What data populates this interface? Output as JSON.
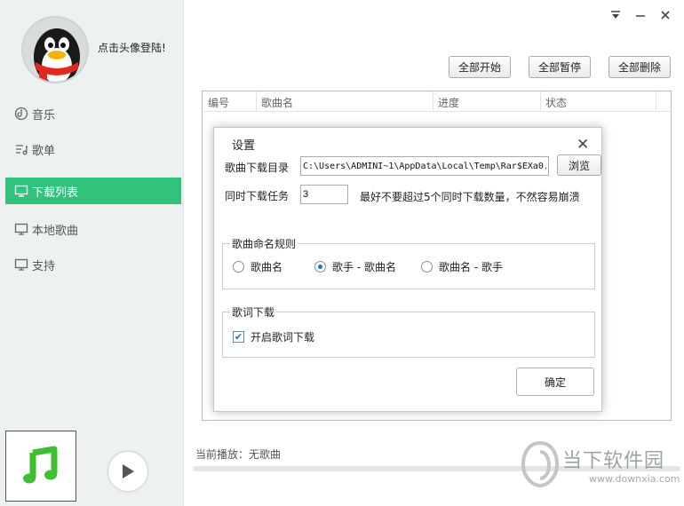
{
  "user": {
    "login_text": "点击头像登陆!"
  },
  "window_controls": {
    "menu": "▼",
    "minimize": "—",
    "close": "✕"
  },
  "sidebar": {
    "items": [
      {
        "label": "音乐",
        "icon": "music-icon",
        "active": false
      },
      {
        "label": "歌单",
        "icon": "playlist-icon",
        "active": false
      },
      {
        "label": "下载列表",
        "icon": "monitor-icon",
        "active": true
      },
      {
        "label": "本地歌曲",
        "icon": "monitor-icon",
        "active": false
      },
      {
        "label": "支持",
        "icon": "monitor-icon",
        "active": false
      }
    ]
  },
  "toolbar": {
    "start_all": "全部开始",
    "pause_all": "全部暂停",
    "delete_all": "全部删除"
  },
  "download_list": {
    "columns": [
      "编号",
      "歌曲名",
      "进度",
      "状态"
    ]
  },
  "player": {
    "now_playing": "当前播放：无歌曲",
    "progress": 0
  },
  "settings_dialog": {
    "title": "设置",
    "download_dir_label": "歌曲下载目录",
    "download_dir_value": "C:\\Users\\ADMINI~1\\AppData\\Local\\Temp\\Rar$EXa0.",
    "browse_label": "浏览",
    "concurrent_label": "同时下载任务",
    "concurrent_value": "3",
    "concurrent_hint": "最好不要超过5个同时下载数量，不然容易崩溃",
    "naming_group_label": "歌曲命名规则",
    "naming_options": [
      {
        "label": "歌曲名",
        "selected": false
      },
      {
        "label": "歌手 - 歌曲名",
        "selected": true
      },
      {
        "label": "歌曲名 - 歌手",
        "selected": false
      }
    ],
    "lyrics_group_label": "歌词下载",
    "lyrics_checkbox_label": "开启歌词下载",
    "lyrics_enabled": true,
    "ok_label": "确定"
  },
  "watermark": {
    "name": "当下软件园",
    "url": "www.downxia.com"
  },
  "colors": {
    "accent": "#31c27c",
    "radio_selected": "#1c6fd6"
  }
}
